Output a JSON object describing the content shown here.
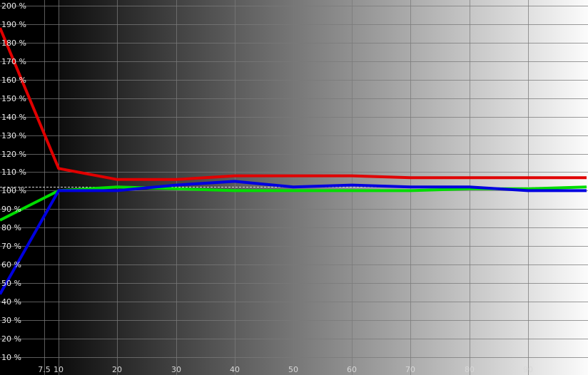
{
  "chart_data": {
    "type": "line",
    "x": [
      0,
      10,
      20,
      30,
      40,
      50,
      60,
      70,
      80,
      90,
      100
    ],
    "series": [
      {
        "color": "#e00000",
        "values": [
          188,
          112,
          106,
          106,
          108,
          108,
          108,
          107,
          107,
          107,
          107
        ]
      },
      {
        "color": "#00dd00",
        "values": [
          84,
          100,
          102,
          101,
          100,
          100,
          100,
          100,
          101,
          101,
          102
        ]
      },
      {
        "color": "#0000e0",
        "values": [
          44,
          100,
          100,
          103,
          105,
          102,
          103,
          102,
          102,
          100,
          100
        ]
      }
    ],
    "reference_value": 102,
    "reference_color": "#d8d8d8",
    "gradient_start_color": "#0d0d0d",
    "gradient_end_color": "#fbfbfb",
    "xlim": [
      0,
      100
    ],
    "ylim": [
      8,
      200
    ],
    "grid": true,
    "x_ticks": [
      {
        "value": 7.5,
        "label": "7.5"
      },
      {
        "value": 10,
        "label": "10"
      },
      {
        "value": 20,
        "label": "20"
      },
      {
        "value": 30,
        "label": "30"
      },
      {
        "value": 40,
        "label": "40"
      },
      {
        "value": 50,
        "label": "50"
      },
      {
        "value": 60,
        "label": "60"
      },
      {
        "value": 70,
        "label": "70"
      },
      {
        "value": 80,
        "label": "80"
      },
      {
        "value": 90,
        "label": "90"
      }
    ],
    "y_ticks": [
      {
        "value": 10,
        "label": "10 %"
      },
      {
        "value": 20,
        "label": "20 %"
      },
      {
        "value": 30,
        "label": "30 %"
      },
      {
        "value": 40,
        "label": "40 %"
      },
      {
        "value": 50,
        "label": "50 %"
      },
      {
        "value": 60,
        "label": "60 %"
      },
      {
        "value": 70,
        "label": "70 %"
      },
      {
        "value": 80,
        "label": "80 %"
      },
      {
        "value": 90,
        "label": "90 %"
      },
      {
        "value": 100,
        "label": "100 %"
      },
      {
        "value": 110,
        "label": "110 %"
      },
      {
        "value": 120,
        "label": "120 %"
      },
      {
        "value": 130,
        "label": "130 %"
      },
      {
        "value": 140,
        "label": "140 %"
      },
      {
        "value": 150,
        "label": "150 %"
      },
      {
        "value": 160,
        "label": "160 %"
      },
      {
        "value": 170,
        "label": "170 %"
      },
      {
        "value": 180,
        "label": "180 %"
      },
      {
        "value": 190,
        "label": "190 %"
      },
      {
        "value": 200,
        "label": "200 %"
      }
    ]
  }
}
